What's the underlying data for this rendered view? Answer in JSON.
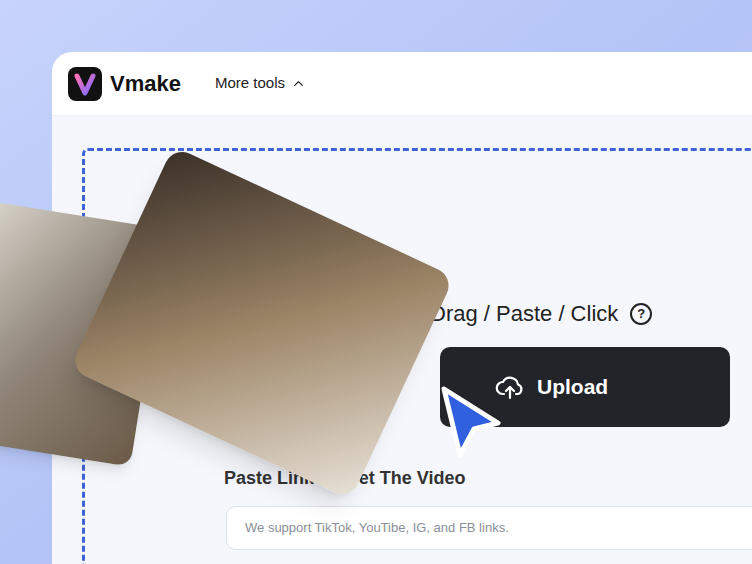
{
  "header": {
    "brand": "Vmake",
    "menu": {
      "label": "More tools",
      "expanded": true
    }
  },
  "uploader": {
    "prompt": "Drag / Paste / Click",
    "help": "?",
    "button": "Upload"
  },
  "link": {
    "label": "Paste Link To Get The Video",
    "placeholder": "We support TikTok, YouTibe, IG, and FB links."
  },
  "photos": [
    {
      "kind": "back"
    },
    {
      "kind": "front"
    }
  ]
}
